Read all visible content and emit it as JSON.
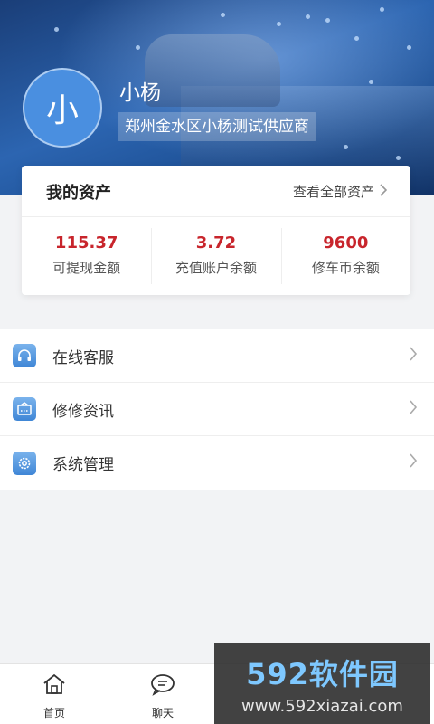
{
  "profile": {
    "avatar_char": "小",
    "name": "小杨",
    "company": "郑州金水区小杨测试供应商"
  },
  "assets": {
    "title": "我的资产",
    "view_all": "查看全部资产",
    "items": [
      {
        "value": "115.37",
        "label": "可提现金额"
      },
      {
        "value": "3.72",
        "label": "充值账户余额"
      },
      {
        "value": "9600",
        "label": "修车币余额"
      }
    ]
  },
  "menu": [
    {
      "label": "在线客服",
      "icon": "headset-icon"
    },
    {
      "label": "修修资讯",
      "icon": "news-icon"
    },
    {
      "label": "系统管理",
      "icon": "gear-icon"
    }
  ],
  "tabbar": [
    {
      "label": "首页",
      "icon": "home-icon"
    },
    {
      "label": "聊天",
      "icon": "chat-icon"
    }
  ],
  "watermark": {
    "brand": "592软件园",
    "url": "www.592xiazai.com"
  },
  "colors": {
    "accent": "#4a8fe0",
    "asset_value": "#c8252c"
  }
}
